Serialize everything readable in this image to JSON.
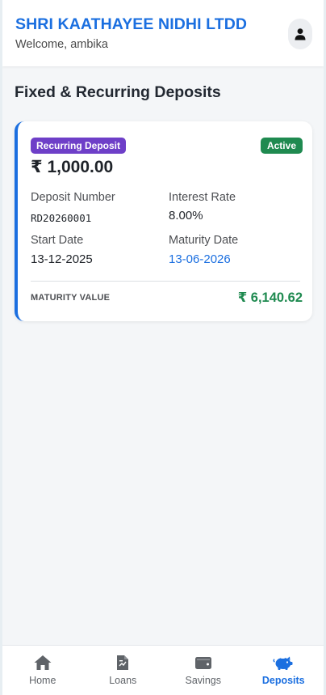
{
  "header": {
    "brand": "SHRI KAATHAYEE NIDHI LTDD",
    "welcome": "Welcome, ambika",
    "profile_icon": "user-icon"
  },
  "page": {
    "title": "Fixed & Recurring Deposits"
  },
  "deposit": {
    "type": "Recurring Deposit",
    "status": "Active",
    "amount": "₹ 1,000.00",
    "deposit_number_label": "Deposit Number",
    "deposit_number": "RD20260001",
    "interest_rate_label": "Interest Rate",
    "interest_rate": "8.00%",
    "start_date_label": "Start Date",
    "start_date": "13-12-2025",
    "maturity_date_label": "Maturity Date",
    "maturity_date": "13-06-2026",
    "maturity_value_label": "MATURITY VALUE",
    "maturity_value": "₹ 6,140.62"
  },
  "nav": {
    "items": [
      {
        "label": "Home",
        "icon": "home-icon"
      },
      {
        "label": "Loans",
        "icon": "document-icon"
      },
      {
        "label": "Savings",
        "icon": "wallet-icon"
      },
      {
        "label": "Deposits",
        "icon": "piggy-bank-icon",
        "active": true
      }
    ]
  },
  "colors": {
    "primary": "#1b6fe0",
    "badge_purple": "#6e3fc8",
    "success_green": "#1f8a50",
    "nav_inactive": "#5f6368"
  }
}
